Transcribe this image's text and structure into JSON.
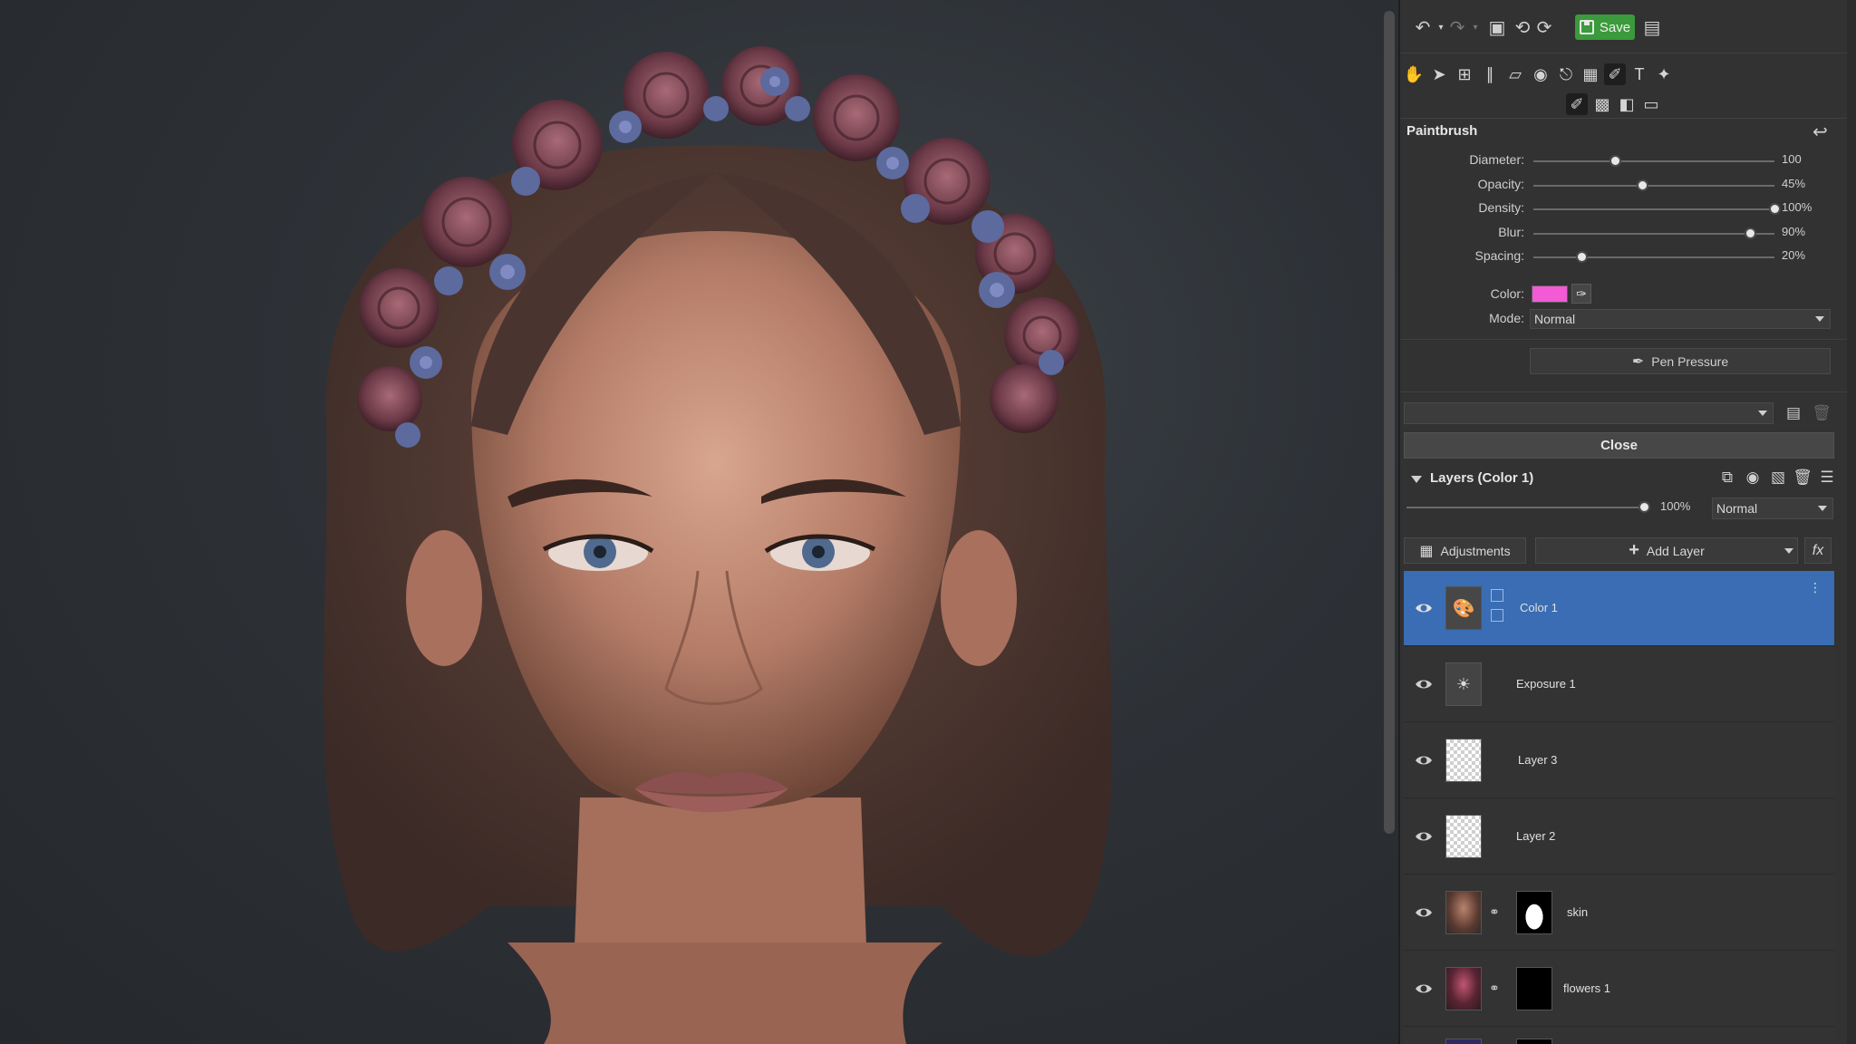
{
  "toolbar": {
    "save_label": "Save",
    "icons": [
      "undo-icon",
      "undo-history-icon",
      "redo-icon",
      "redo-history-icon",
      "image-icon",
      "rotate-left-icon",
      "rotate-right-icon",
      "export-icon"
    ]
  },
  "tools_row1": [
    "hand-icon",
    "pointer-icon",
    "crop-icon",
    "straighten-icon",
    "perspective-icon",
    "red-eye-icon",
    "clone-icon",
    "grid-icon",
    "brush-tool-icon",
    "text-icon",
    "effects-icon"
  ],
  "tools_row2": [
    "paintbrush-icon",
    "bucket-icon",
    "gradient-icon",
    "eraser-icon"
  ],
  "paintbrush": {
    "title": "Paintbrush",
    "params": [
      {
        "label": "Diameter:",
        "value": "100",
        "level": 0.34
      },
      {
        "label": "Opacity:",
        "value": "45%",
        "level": 0.45
      },
      {
        "label": "Density:",
        "value": "100%",
        "level": 1.0
      },
      {
        "label": "Blur:",
        "value": "90%",
        "level": 0.9
      },
      {
        "label": "Spacing:",
        "value": "20%",
        "level": 0.2
      }
    ],
    "color_label": "Color:",
    "color_value": "#f25ad6",
    "mode_label": "Mode:",
    "mode_value": "Normal",
    "pen_pressure_label": "Pen Pressure",
    "preset_value": "",
    "close_label": "Close"
  },
  "layers": {
    "title": "Layers (Color 1)",
    "opacity_value": "100%",
    "opacity_level": 1.0,
    "blend_mode": "Normal",
    "adjustments_label": "Adjustments",
    "add_layer_label": "Add Layer",
    "fx_label": "fx",
    "items": [
      {
        "name": "Color 1",
        "type": "adjustment-color",
        "selected": true
      },
      {
        "name": "Exposure 1",
        "type": "adjustment-exposure",
        "selected": false
      },
      {
        "name": "Layer 3",
        "type": "transparent",
        "selected": false
      },
      {
        "name": "Layer 2",
        "type": "transparent",
        "selected": false
      },
      {
        "name": "skin",
        "type": "masked-photo",
        "selected": false
      },
      {
        "name": "flowers 1",
        "type": "masked-photo",
        "selected": false
      }
    ]
  }
}
